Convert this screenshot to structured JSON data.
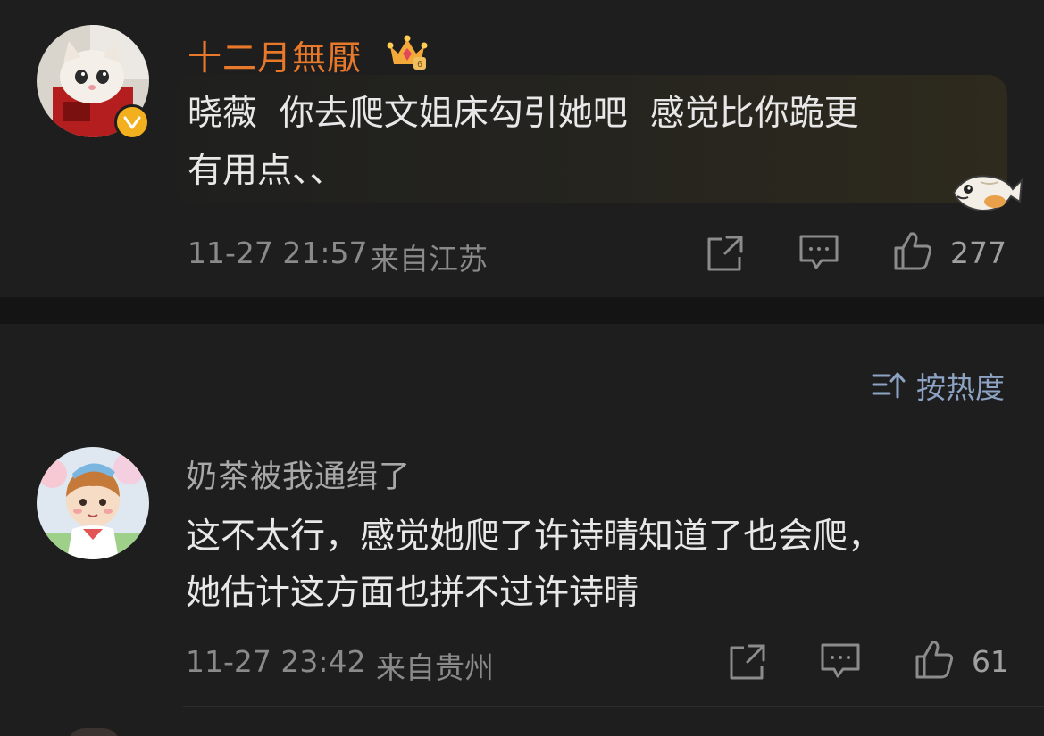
{
  "comments": [
    {
      "username": "十二月無厭",
      "vip": true,
      "verified": true,
      "text_lines": [
        "晓薇  你去爬文姐床勾引她吧  感觉比你跪更",
        "有用点、、"
      ],
      "timestamp": "11-27 21:57",
      "location": "来自江苏",
      "likes": "277",
      "icons": [
        "share-icon",
        "comment-icon",
        "like-icon"
      ]
    },
    {
      "username": "奶茶被我通缉了",
      "vip": false,
      "verified": false,
      "text_lines": [
        "这不太行，感觉她爬了许诗晴知道了也会爬，",
        "她估计这方面也拼不过许诗晴"
      ],
      "timestamp": "11-27 23:42",
      "location": "来自贵州",
      "likes": "61",
      "icons": [
        "share-icon",
        "comment-icon",
        "like-icon"
      ]
    }
  ],
  "sort": {
    "label": "按热度",
    "icon": "sort-icon"
  },
  "colors": {
    "background": "#1e1e1e",
    "separator": "#141414",
    "vip_name": "#e8782a",
    "sort_accent": "#8da3c4",
    "badge": "#f2b01e"
  }
}
